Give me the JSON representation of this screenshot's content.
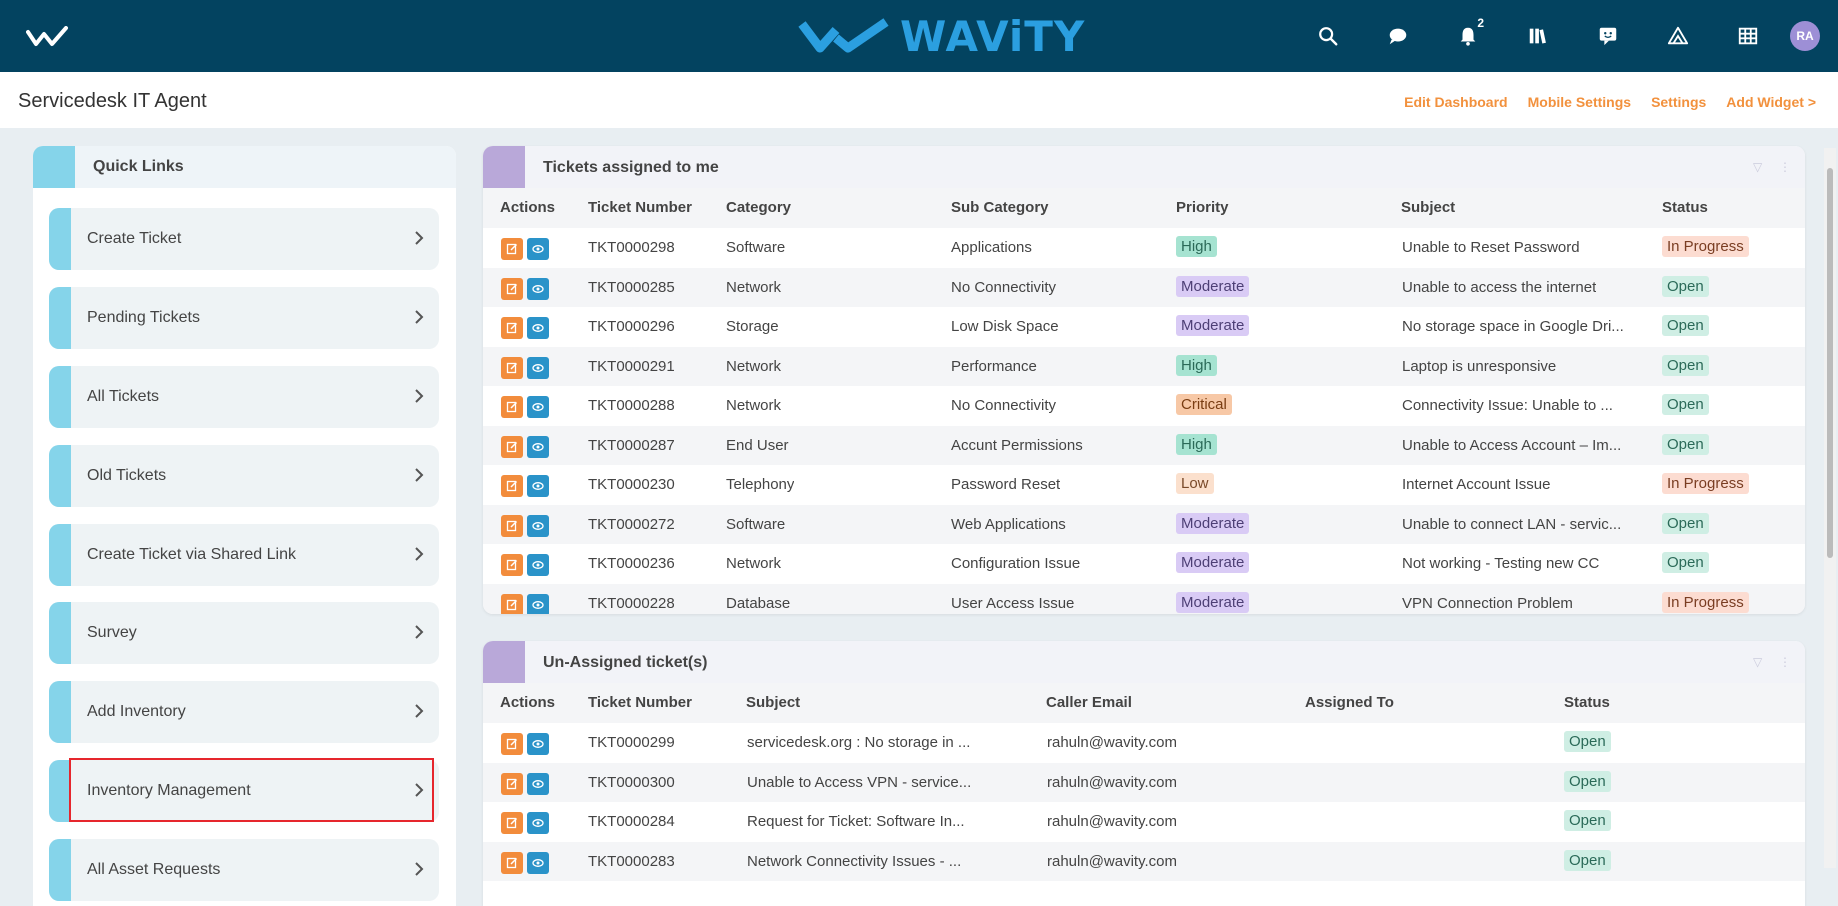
{
  "app": {
    "brand": "WAViTY",
    "notif_count": "2",
    "avatar": "RA"
  },
  "page": {
    "title": "Servicedesk IT Agent",
    "actions": [
      "Edit Dashboard",
      "Mobile Settings",
      "Settings",
      "Add Widget >"
    ]
  },
  "quick_links": {
    "title": "Quick Links",
    "items": [
      "Create Ticket",
      "Pending Tickets",
      "All Tickets",
      "Old Tickets",
      "Create Ticket via Shared Link",
      "Survey",
      "Add Inventory",
      "Inventory Management",
      "All Asset Requests"
    ]
  },
  "assigned": {
    "title": "Tickets assigned to me",
    "headers": [
      "Actions",
      "Ticket Number",
      "Category",
      "Sub Category",
      "Priority",
      "Subject",
      "Status"
    ],
    "rows": [
      [
        "TKT0000298",
        "Software",
        "Applications",
        "High",
        "Unable to Reset Password",
        "In Progress"
      ],
      [
        "TKT0000285",
        "Network",
        "No Connectivity",
        "Moderate",
        "Unable to access the internet",
        "Open"
      ],
      [
        "TKT0000296",
        "Storage",
        "Low Disk Space",
        "Moderate",
        "No storage space in Google Dri...",
        "Open"
      ],
      [
        "TKT0000291",
        "Network",
        "Performance",
        "High",
        "Laptop is unresponsive",
        "Open"
      ],
      [
        "TKT0000288",
        "Network",
        "No Connectivity",
        "Critical",
        "Connectivity Issue: Unable to ...",
        "Open"
      ],
      [
        "TKT0000287",
        "End User",
        "Accunt Permissions",
        "High",
        "Unable to Access Account – Im...",
        "Open"
      ],
      [
        "TKT0000230",
        "Telephony",
        "Password Reset",
        "Low",
        "Internet Account Issue",
        "In Progress"
      ],
      [
        "TKT0000272",
        "Software",
        "Web Applications",
        "Moderate",
        "Unable to connect LAN - servic...",
        "Open"
      ],
      [
        "TKT0000236",
        "Network",
        "Configuration Issue",
        "Moderate",
        "Not working - Testing new CC",
        "Open"
      ],
      [
        "TKT0000228",
        "Database",
        "User Access Issue",
        "Moderate",
        "VPN Connection Problem",
        "In Progress"
      ]
    ]
  },
  "unassigned": {
    "title": "Un-Assigned ticket(s)",
    "headers": [
      "Actions",
      "Ticket Number",
      "Subject",
      "Caller Email",
      "Assigned To",
      "Status"
    ],
    "rows": [
      [
        "TKT0000299",
        "servicedesk.org : No storage in ...",
        "rahuln@wavity.com",
        "",
        "Open"
      ],
      [
        "TKT0000300",
        "Unable to Access VPN - service...",
        "rahuln@wavity.com",
        "",
        "Open"
      ],
      [
        "TKT0000284",
        "Request for Ticket: Software In...",
        "rahuln@wavity.com",
        "",
        "Open"
      ],
      [
        "TKT0000283",
        "Network Connectivity Issues - ...",
        "rahuln@wavity.com",
        "",
        "Open"
      ]
    ]
  }
}
